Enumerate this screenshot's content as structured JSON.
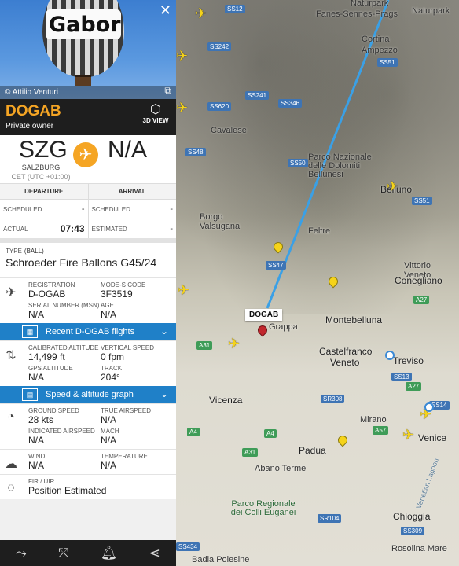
{
  "panel": {
    "photo_credit": "© Attilio Venturi",
    "balloon_text": "Gabor",
    "callsign": "DOGAB",
    "owner": "Private owner",
    "view3d_label": "3D VIEW",
    "route": {
      "from_code": "SZG",
      "from_city": "SALZBURG",
      "from_tz": "CET (UTC +01:00)",
      "to_code": "N/A"
    },
    "times": {
      "departure_header": "DEPARTURE",
      "arrival_header": "ARRIVAL",
      "scheduled_label": "SCHEDULED",
      "scheduled_dep": "-",
      "scheduled_arr": "-",
      "actual_label": "ACTUAL",
      "actual_dep": "07:43",
      "estimated_label": "ESTIMATED",
      "estimated_arr": "-"
    },
    "aircraft": {
      "type_label": "TYPE",
      "type_code": "(BALL)",
      "model": "Schroeder Fire Ballons G45/24",
      "registration_label": "REGISTRATION",
      "registration": "D-OGAB",
      "modes_label": "MODE-S CODE",
      "modes": "3F3519",
      "serial_label": "SERIAL NUMBER (MSN)",
      "serial": "N/A",
      "age_label": "AGE",
      "age": "N/A"
    },
    "recent_flights_label": "Recent D-OGAB flights",
    "altitude": {
      "cal_alt_label": "CALIBRATED ALTITUDE",
      "cal_alt": "14,499 ft",
      "vspeed_label": "VERTICAL SPEED",
      "vspeed": "0 fpm",
      "gps_alt_label": "GPS ALTITUDE",
      "gps_alt": "N/A",
      "track_label": "TRACK",
      "track": "204°"
    },
    "graph_label": "Speed & altitude graph",
    "speed": {
      "ground_label": "GROUND SPEED",
      "ground": "28 kts",
      "true_label": "TRUE AIRSPEED",
      "true": "N/A",
      "indicated_label": "INDICATED AIRSPEED",
      "indicated": "N/A",
      "mach_label": "MACH",
      "mach": "N/A"
    },
    "weather": {
      "wind_label": "WIND",
      "wind": "N/A",
      "temp_label": "TEMPERATURE",
      "temp": "N/A"
    },
    "fir": {
      "fir_label": "FIR / UIR",
      "fir": "Position Estimated"
    }
  },
  "map": {
    "flight_label": "DOGAB",
    "places": {
      "naturpark": "Naturpark",
      "naturpark2": "Naturpark",
      "fanes": "Fanes-Sennes-Prags",
      "cortina": "Cortina",
      "ampezzo": "Ampezzo",
      "cavalese": "Cavalese",
      "belluno": "Belluno",
      "dolomiti": "Parco Nazionale delle Dolomiti Bellunesi",
      "feltre": "Feltre",
      "borgo": "Borgo Valsugana",
      "vittorio": "Vittorio Veneto",
      "conegliano": "Conegliano",
      "grappa": "Grappa",
      "montebelluna": "Montebelluna",
      "castelfranco": "Castelfranco",
      "veneto": "Veneto",
      "treviso": "Treviso",
      "vicenza": "Vicenza",
      "mirano": "Mirano",
      "padua": "Padua",
      "venice": "Venice",
      "abano": "Abano Terme",
      "parco_colli": "Parco Regionale dei Colli Euganei",
      "chioggia": "Chioggia",
      "rosolina": "Rosolina Mare",
      "badia": "Badia Polesine",
      "laguna": "Venetian Lagoon"
    },
    "roads": [
      "SS12",
      "SS51",
      "SS242",
      "SS241",
      "SS346",
      "SS620",
      "SS48",
      "SS50",
      "SS51",
      "SS47",
      "A27",
      "A31",
      "SS13",
      "A27",
      "SR308",
      "A4",
      "A57",
      "SS14",
      "A31",
      "A4",
      "SR104",
      "SS309",
      "SS434"
    ]
  },
  "toolbar": {
    "icons": [
      "route-icon",
      "expand-icon",
      "bell-icon",
      "share-icon"
    ]
  },
  "colors": {
    "accent_orange": "#f5a524",
    "bar_blue": "#1f80c8",
    "track_line": "#3aa0e6",
    "plane_yellow": "#f5d31a"
  }
}
